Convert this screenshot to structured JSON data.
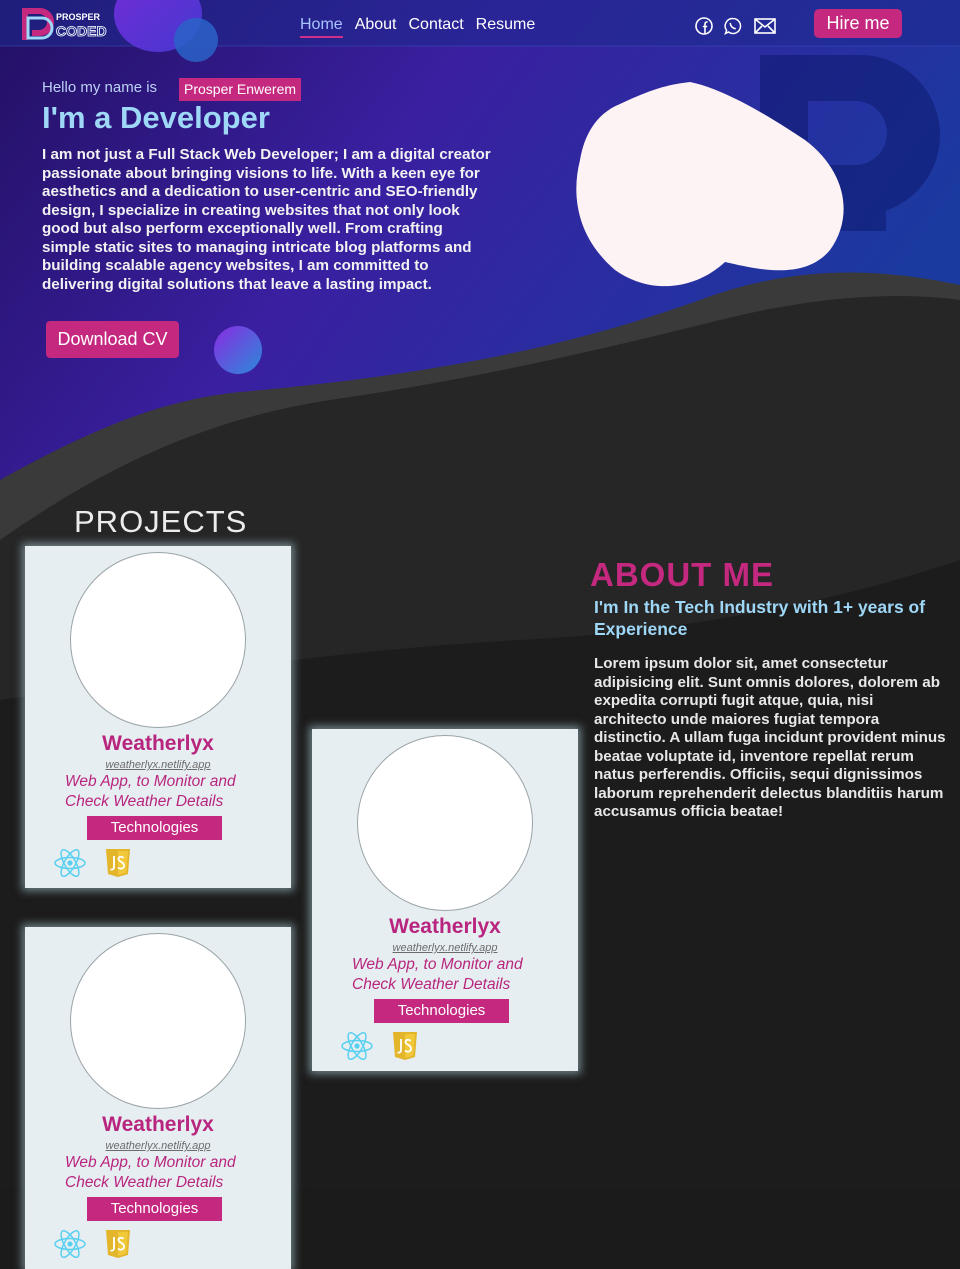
{
  "brand": {
    "logo_small": "PROSPER",
    "logo_big": "CODED"
  },
  "nav": {
    "items": [
      "Home",
      "About",
      "Contact",
      "Resume"
    ],
    "active": "Home"
  },
  "social": [
    "facebook-icon",
    "whatsapp-icon",
    "mail-icon"
  ],
  "header": {
    "hire_label": "Hire me"
  },
  "hero": {
    "hello": "Hello my name is",
    "name": "Prosper Enwerem",
    "role": "I'm a Developer",
    "intro": "I am not just a Full Stack Web Developer; I am a digital creator passionate about bringing visions to life. With a keen eye for aesthetics and a dedication to user-centric and SEO-friendly design, I specialize in creating websites that not only look good but also perform exceptionally well. From crafting simple static sites to managing intricate blog platforms and building scalable agency websites, I am committed to delivering digital solutions that leave a lasting impact.",
    "cv_label": "Download CV"
  },
  "projects": {
    "title": "PROJECTS",
    "items": [
      {
        "title": "Weatherlyx",
        "link": "weatherlyx.netlify.app",
        "desc": "Web App, to Monitor and Check Weather Details",
        "tech_label": "Technologies",
        "tech_icons": [
          "react-icon",
          "js-icon"
        ]
      },
      {
        "title": "Weatherlyx",
        "link": "weatherlyx.netlify.app",
        "desc": "Web App, to Monitor and Check Weather Details",
        "tech_label": "Technologies",
        "tech_icons": [
          "react-icon",
          "js-icon"
        ]
      },
      {
        "title": "Weatherlyx",
        "link": "weatherlyx.netlify.app",
        "desc": "Web App, to Monitor and Check Weather Details",
        "tech_label": "Technologies",
        "tech_icons": [
          "react-icon",
          "js-icon"
        ]
      }
    ]
  },
  "about": {
    "title": "ABOUT ME",
    "subtitle": "I'm In the Tech Industry with 1+ years of Experience",
    "text": "Lorem ipsum dolor sit, amet consectetur adipisicing elit. Sunt omnis dolores, dolorem ab expedita corrupti fugit atque, quia, nisi architecto unde maiores fugiat tempora distinctio. A ullam fuga incidunt provident minus beatae voluptate id, inventore repellat rerum natus perferendis. Officiis, sequi dignissimos laborum reprehenderit delectus blanditiis harum accusamus officia beatae!"
  },
  "colors": {
    "accent": "#c4287f",
    "heading_blue": "#9fd7f7",
    "hero_bg_top": "#1c2a8a",
    "dark_bg": "#1b1b1b"
  }
}
